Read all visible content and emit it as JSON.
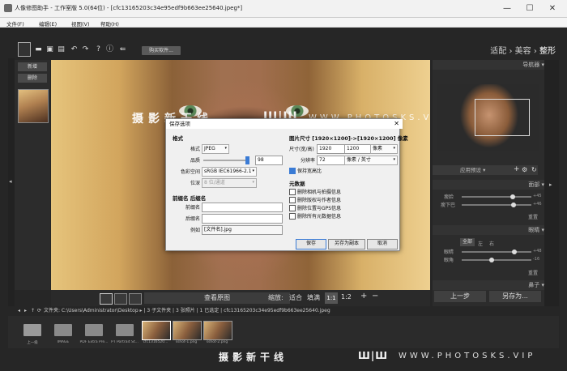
{
  "window": {
    "title": "人像修图助手 - 工作室版 5.0(64位) - [cfc13165203c34e95edf9b663ee25640.jpeg*]",
    "controls": [
      "—",
      "☐",
      "✕"
    ]
  },
  "menu": [
    "文件(F)",
    "编辑(E)",
    "视图(V)",
    "帮助(H)"
  ],
  "toolbar": {
    "buy_label": "购买软件...",
    "modes": {
      "a": "适配",
      "sep": " › ",
      "b": "美容",
      "c": "整形"
    }
  },
  "left_panel": {
    "new_label": "新增",
    "delete_label": "删除"
  },
  "watermark": {
    "main": "摄影新干线",
    "logo": "Ш|Ш",
    "url": "WWW.PHOTOSKS.VIP"
  },
  "bottom_bar": {
    "view_original": "查看原图",
    "zoom_label": "缩放:",
    "fit_label": "适合",
    "fill_label": "填满",
    "z11": "1:1",
    "z12": "1:2",
    "plus": "+",
    "minus": "−"
  },
  "right_panel": {
    "navigator": "导航器",
    "preset": "应用预设",
    "face_head": "面部",
    "face_s1": "瘦脸",
    "face_s2": "瘦下巴",
    "face_v1": "+45",
    "face_v2": "+46",
    "reset1": "重置",
    "eyes_head": "眼睛",
    "eyes_all": "全部",
    "eyes_left": "左",
    "eyes_right": "右",
    "eyes_s1": "眼睛",
    "eyes_s2": "眼角",
    "eyes_v1": "+48",
    "eyes_v2": "-16",
    "reset2": "重置",
    "nose_head": "鼻子",
    "prev_step": "上一步",
    "save_as": "另存为..."
  },
  "path_bar": {
    "text": "文件夹: C:\\Users\\Administrator\\Desktop ▸ | 3 子文件夹 | 3 张照片 | 1 已选定 | cfc13165203c34e95edf9b663ee25640.jpeg"
  },
  "filmstrip": [
    {
      "type": "up",
      "caption": "上一级"
    },
    {
      "type": "folder",
      "caption": "IMAGE"
    },
    {
      "type": "folder",
      "caption": "PDF Extra Pre..."
    },
    {
      "type": "folder",
      "caption": "PT Portrait St..."
    },
    {
      "type": "thumb",
      "caption": "cfc1316520..."
    },
    {
      "type": "thumb",
      "caption": "sshot-1.png"
    },
    {
      "type": "thumb",
      "caption": "sshot-2.png"
    }
  ],
  "dialog": {
    "title": "保存选项",
    "close": "✕",
    "format_section": "格式",
    "format_label": "格式",
    "format_value": "JPEG",
    "quality_label": "品质",
    "quality_value": "98",
    "quality_fraction": 0.98,
    "colorspace_label": "色彩空间",
    "colorspace_value": "sRGB IEC61966-2.1",
    "bitdepth_label": "位深",
    "bitdepth_value": "8 位/通道",
    "prefix_section": "前缀名 后缀名",
    "prefix_label": "前缀名",
    "suffix_label": "后缀名",
    "example_label": "例如",
    "example_value": "[文件名].jpg",
    "size_section": "图片尺寸 [1920×1200]->[1920×1200] 像素",
    "size_label": "尺寸(宽/高)",
    "width": "1920",
    "height": "1200",
    "size_unit": "像素",
    "res_label": "分辨率",
    "res_value": "72",
    "res_unit": "像素 / 英寸",
    "keep_ratio": "保持宽高比",
    "meta_section": "元数据",
    "meta_items": [
      "删除相机与拍摄信息",
      "删除版权与作者信息",
      "删除位置与GPS信息",
      "删除所有元数据信息"
    ],
    "save_btn": "保存",
    "save_copy_btn": "另存为副本",
    "cancel_btn": "取消"
  }
}
